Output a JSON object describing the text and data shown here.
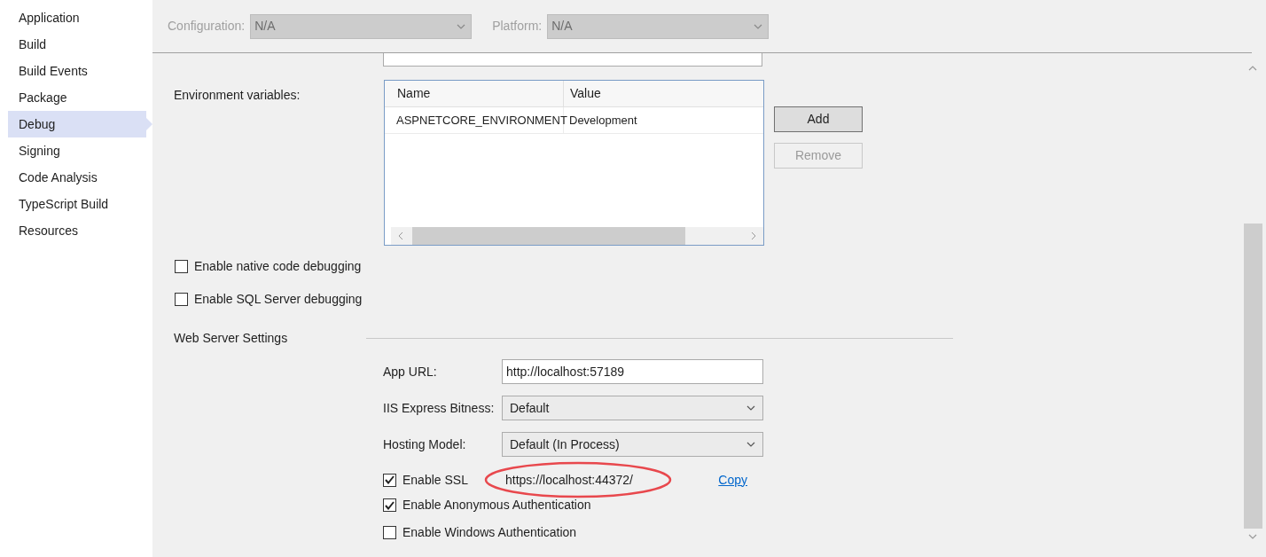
{
  "sidebar": {
    "items": [
      {
        "label": "Application",
        "selected": false
      },
      {
        "label": "Build",
        "selected": false
      },
      {
        "label": "Build Events",
        "selected": false
      },
      {
        "label": "Package",
        "selected": false
      },
      {
        "label": "Debug",
        "selected": true
      },
      {
        "label": "Signing",
        "selected": false
      },
      {
        "label": "Code Analysis",
        "selected": false
      },
      {
        "label": "TypeScript Build",
        "selected": false
      },
      {
        "label": "Resources",
        "selected": false
      }
    ]
  },
  "toolbar": [
    {
      "label": "Configuration:",
      "value": "N/A",
      "disabled": true
    },
    {
      "label": "Platform:",
      "value": "N/A",
      "disabled": true
    }
  ],
  "environment": {
    "label": "Environment variables:",
    "columns": [
      "Name",
      "Value"
    ],
    "rows": [
      [
        "ASPNETCORE_ENVIRONMENT",
        "Development"
      ]
    ],
    "buttons": [
      {
        "label": "Add",
        "disabled": false
      },
      {
        "label": "Remove",
        "disabled": true
      }
    ]
  },
  "debug_options": [
    {
      "label": "Enable native code debugging",
      "checked": false
    },
    {
      "label": "Enable SQL Server debugging",
      "checked": false
    }
  ],
  "web_server": {
    "title": "Web Server Settings",
    "fields": [
      {
        "kind": "text",
        "label": "App URL:",
        "value": "http://localhost:57189"
      },
      {
        "kind": "select",
        "label": "IIS Express Bitness:",
        "value": "Default"
      },
      {
        "kind": "select",
        "label": "Hosting Model:",
        "value": "Default (In Process)"
      }
    ],
    "ssl": {
      "label": "Enable SSL",
      "checked": true,
      "url": "https://localhost:44372/",
      "link": "Copy"
    },
    "auth": [
      {
        "label": "Enable Anonymous Authentication",
        "checked": true
      },
      {
        "label": "Enable Windows Authentication",
        "checked": false
      }
    ]
  }
}
